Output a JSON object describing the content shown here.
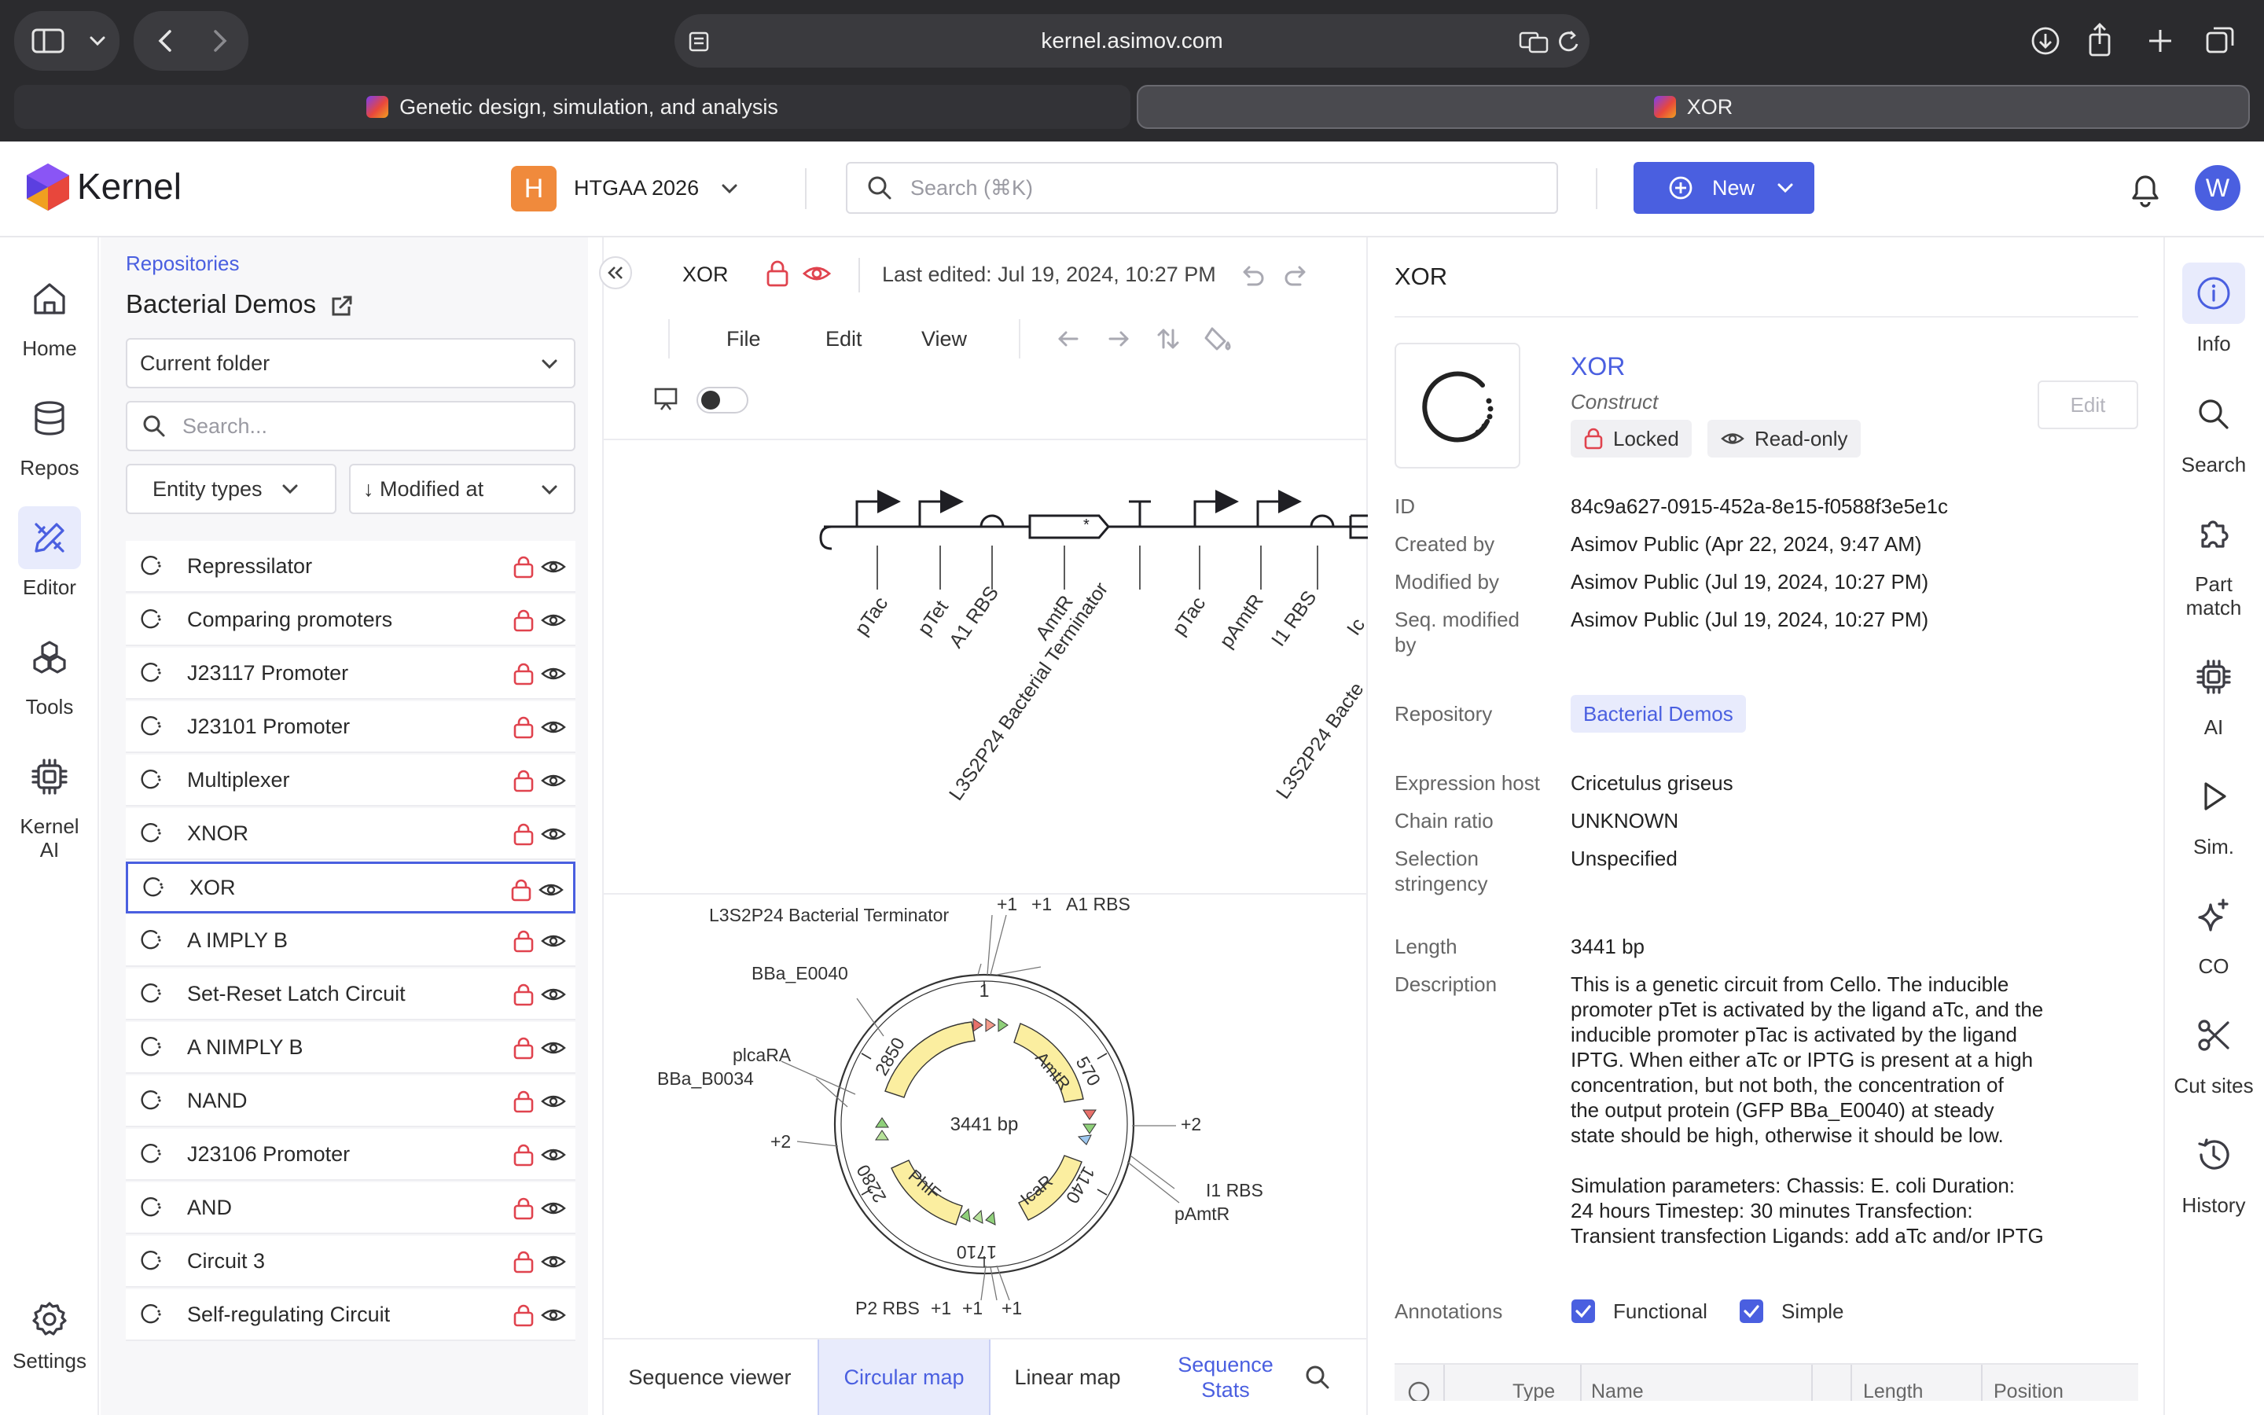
{
  "browser": {
    "url": "kernel.asimov.com",
    "tabs": [
      {
        "label": "Genetic design, simulation, and analysis"
      },
      {
        "label": "XOR"
      }
    ]
  },
  "header": {
    "app_name": "Kernel",
    "workspace_initial": "H",
    "workspace_name": "HTGAA 2026",
    "search_placeholder": "Search (⌘K)",
    "new_button": "New",
    "user_initial": "W"
  },
  "left_nav": {
    "items": [
      {
        "label": "Home",
        "icon": "home-icon"
      },
      {
        "label": "Repos",
        "icon": "database-icon"
      },
      {
        "label": "Editor",
        "icon": "editor-icon",
        "active": true
      },
      {
        "label": "Tools",
        "icon": "tools-icon"
      },
      {
        "label": "Kernel",
        "label2": "AI",
        "icon": "chip-icon"
      },
      {
        "label": "Settings",
        "icon": "gear-icon"
      }
    ]
  },
  "sidebar": {
    "breadcrumb": "Repositories",
    "title": "Bacterial Demos",
    "folder_select": "Current folder",
    "search_placeholder": "Search...",
    "entity_types": "Entity types",
    "sort": "↓ Modified at",
    "items": [
      {
        "label": "Repressilator"
      },
      {
        "label": "Comparing promoters"
      },
      {
        "label": "J23117 Promoter"
      },
      {
        "label": "J23101 Promoter"
      },
      {
        "label": "Multiplexer"
      },
      {
        "label": "XNOR"
      },
      {
        "label": "XOR",
        "selected": true
      },
      {
        "label": "A IMPLY B"
      },
      {
        "label": "Set-Reset Latch Circuit"
      },
      {
        "label": "A NIMPLY B"
      },
      {
        "label": "NAND"
      },
      {
        "label": "J23106 Promoter"
      },
      {
        "label": "AND"
      },
      {
        "label": "Circuit 3"
      },
      {
        "label": "Self-regulating Circuit"
      }
    ]
  },
  "editor": {
    "doc_name": "XOR",
    "last_edited": "Last edited: Jul 19, 2024, 10:27 PM",
    "menus": {
      "file": "File",
      "edit": "Edit",
      "view": "View"
    },
    "linear_labels": {
      "ptac1": "pTac",
      "ptet": "pTet",
      "a1rbs": "A1 RBS",
      "amtr": "AmtR",
      "term": "L3S2P24 Bacterial Terminator",
      "ptac2": "pTac",
      "pamtr": "pAmtR",
      "i1rbs": "I1 RBS",
      "cut": "Ic",
      "term2": "L3S2P24 Bacte"
    },
    "map": {
      "center_label": "3441 bp",
      "ticks": {
        "t1": "1",
        "t570": "570",
        "t1140": "1140",
        "t1710": "1710",
        "t2280": "2280",
        "t2850": "2850"
      },
      "features": {
        "amtr": "AmtR",
        "icar": "IcaR",
        "phlf": "PhlF"
      },
      "labels": {
        "term": "L3S2P24 Bacterial Terminator",
        "p1a": "+1",
        "p1b": "+1",
        "a1rbs": "A1 RBS",
        "bba_e0040": "BBa_E0040",
        "plcar": "plcaRA",
        "bba_b0034": "BBa_B0034",
        "p2left": "+2",
        "p2right": "+2",
        "i1rbs": "I1 RBS",
        "pamtr": "pAmtR",
        "p2rbs": "P2 RBS",
        "p1c": "+1",
        "p1d": "+1",
        "p1e": "+1"
      }
    },
    "bottom_tabs": {
      "seq_viewer": "Sequence viewer",
      "circular": "Circular map",
      "linear": "Linear map",
      "stats1": "Sequence",
      "stats2": "Stats"
    }
  },
  "details": {
    "title": "XOR",
    "name": "XOR",
    "type": "Construct",
    "locked": "Locked",
    "readonly": "Read-only",
    "edit": "Edit",
    "id_key": "ID",
    "id_val": "84c9a627-0915-452a-8e15-f0588f3e5e1c",
    "created_key": "Created by",
    "created_val": "Asimov Public (Apr 22, 2024, 9:47 AM)",
    "modified_key": "Modified by",
    "modified_val": "Asimov Public (Jul 19, 2024, 10:27 PM)",
    "seqmod_key1": "Seq. modified",
    "seqmod_key2": "by",
    "seqmod_val": "Asimov Public (Jul 19, 2024, 10:27 PM)",
    "repo_key": "Repository",
    "repo_val": "Bacterial Demos",
    "host_key": "Expression host",
    "host_val": "Cricetulus griseus",
    "chain_key": "Chain ratio",
    "chain_val": "UNKNOWN",
    "sel_key1": "Selection",
    "sel_key2": "stringency",
    "sel_val": "Unspecified",
    "length_key": "Length",
    "length_val": "3441 bp",
    "desc_key": "Description",
    "desc_lines": [
      "This is a genetic circuit from Cello. The inducible",
      "promoter pTet is activated by the ligand aTc, and the",
      "inducible promoter pTac is activated by the ligand",
      "IPTG. When either aTc or IPTG is present at a high",
      "concentration, but not both, the concentration of",
      "the output protein (GFP BBa_E0040) at steady",
      "state should be high, otherwise it should be low.",
      "",
      "Simulation parameters: Chassis: E. coli Duration:",
      "24 hours Timestep: 30 minutes Transfection:",
      "Transient transfection Ligands: add aTc and/or IPTG"
    ],
    "annotations_key": "Annotations",
    "functional": "Functional",
    "simple": "Simple",
    "table_headers": {
      "type": "Type",
      "name": "Name",
      "length": "Length",
      "position": "Position"
    }
  },
  "right_rail": {
    "items": [
      {
        "label": "Info",
        "icon": "info-icon",
        "active": true
      },
      {
        "label": "Search",
        "icon": "search-icon"
      },
      {
        "label": "Part",
        "label2": "match",
        "icon": "puzzle-icon"
      },
      {
        "label": "AI",
        "icon": "chip-icon"
      },
      {
        "label": "Sim.",
        "icon": "play-icon"
      },
      {
        "label": "CO",
        "icon": "sparkle-icon"
      },
      {
        "label": "Cut sites",
        "icon": "scissors-icon"
      },
      {
        "label": "History",
        "icon": "history-icon"
      }
    ]
  },
  "colors": {
    "accent": "#4a5fe0",
    "locked_red": "#e0434e",
    "feature_yellow": "#fbeea0",
    "chrome_bg": "#2b2b2e"
  }
}
